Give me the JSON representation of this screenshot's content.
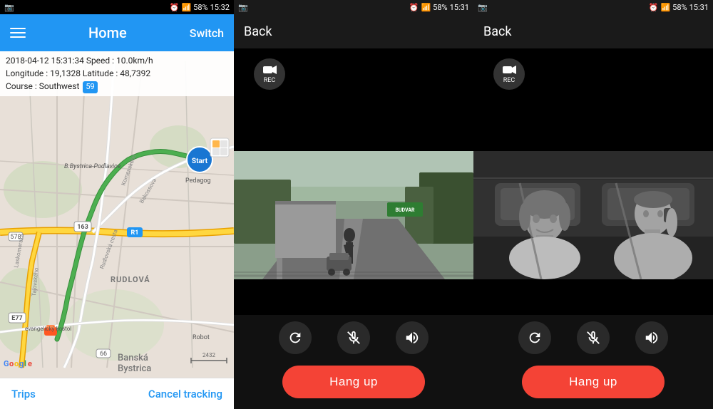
{
  "panel1": {
    "statusBar": {
      "left": "📷",
      "time": "15:32",
      "icons": "alarm wifi signal battery"
    },
    "topBar": {
      "title": "Home",
      "switchLabel": "Switch"
    },
    "infoBar": {
      "line1": "2018-04-12  15:31:34   Speed : 10.0km/h",
      "line2": "Longitude : 19,1328   Latitude : 48,7392",
      "line3": "Course : Southwest",
      "badge": "59"
    },
    "bottomBar": {
      "tripsLabel": "Trips",
      "cancelLabel": "Cancel tracking"
    }
  },
  "panel2": {
    "statusBar": {
      "time": "15:31"
    },
    "topBar": {
      "backLabel": "Back"
    },
    "recLabel": "REC",
    "hangupLabel": "Hang up",
    "controls": {
      "refresh": "↺",
      "mic": "🎤",
      "speaker": "🔊"
    }
  },
  "panel3": {
    "statusBar": {
      "time": "15:31"
    },
    "topBar": {
      "backLabel": "Back"
    },
    "recLabel": "REC",
    "hangupLabel": "Hang up",
    "controls": {
      "refresh": "↺",
      "mic": "🎤",
      "speaker": "🔊"
    }
  },
  "map": {
    "labels": {
      "bBystricaPodlavice": "B.Bystrica-Podlavice",
      "rudlova": "RUDLOVÁ",
      "banskaBystrica": "Banská\nBystrica",
      "evanjelickyKostol": "evangelický kostol",
      "pedagog": "Pedagog",
      "robot": "Robot",
      "e77": "E77",
      "r1": "R1",
      "road163": "163",
      "road578": "578",
      "road66": "66"
    }
  },
  "colors": {
    "blue": "#2196f3",
    "green": "#4caf50",
    "red": "#f44336",
    "orange": "#ff5722",
    "darkBg": "#111111"
  }
}
